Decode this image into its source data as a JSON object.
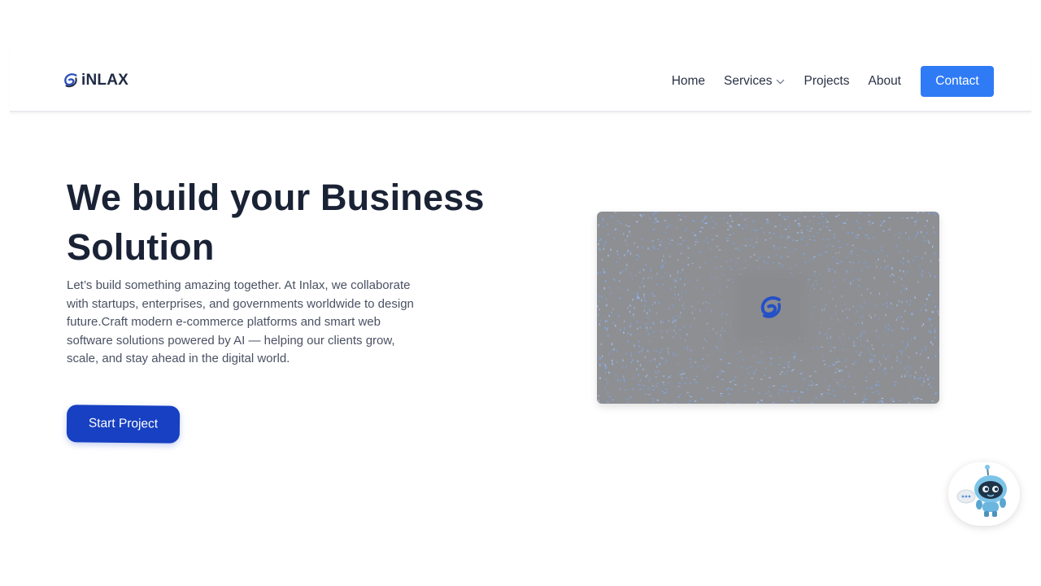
{
  "brand": {
    "logo_text": "iNLAX",
    "logo_icon": "inlax-swirl-icon",
    "accent_color": "#2f7bf6"
  },
  "nav": {
    "items": [
      {
        "label": "Home"
      },
      {
        "label": "Services",
        "icon": "chevron-down-icon"
      },
      {
        "label": "Projects"
      },
      {
        "label": "About"
      }
    ],
    "contact_label": "Contact"
  },
  "hero": {
    "title": "We build your Business Solution",
    "description": "Let’s build something amazing together. At Inlax, we collaborate with startups, enterprises, and governments worldwide to design future.Craft modern e-commerce platforms and smart web software solutions powered by AI — helping our clients grow, scale, and stay ahead in the digital world.",
    "cta_label": "Start Project",
    "cta_color": "#1740c2",
    "image_icon": "inlax-swirl-icon"
  },
  "chat_widget": {
    "icon": "chatbot-robot-icon"
  }
}
